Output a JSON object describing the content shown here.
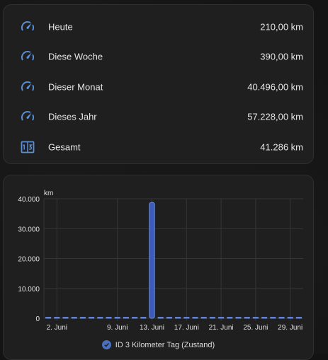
{
  "entities": [
    {
      "icon": "speedometer-icon",
      "name": "Heute",
      "value": "210,00 km"
    },
    {
      "icon": "speedometer-icon",
      "name": "Diese Woche",
      "value": "390,00 km"
    },
    {
      "icon": "speedometer-icon",
      "name": "Dieser Monat",
      "value": "40.496,00 km"
    },
    {
      "icon": "speedometer-icon",
      "name": "Dieses Jahr",
      "value": "57.228,00 km"
    },
    {
      "icon": "counter-icon",
      "name": "Gesamt",
      "value": "41.286 km"
    }
  ],
  "colors": {
    "icon": "#5b8fd6",
    "bar_fill": "#3b5cb8",
    "bar_stroke": "#6d8de0",
    "grid": "#353535"
  },
  "chart_data": {
    "type": "bar",
    "ylabel": "km",
    "ylim": [
      0,
      40000
    ],
    "yticks": [
      "40.000",
      "30.000",
      "20.000",
      "10.000",
      "0"
    ],
    "ytick_values": [
      40000,
      30000,
      20000,
      10000,
      0
    ],
    "xticks": [
      "2. Juni",
      "9. Juni",
      "13. Juni",
      "17. Juni",
      "21. Juni",
      "25. Juni",
      "29. Juni"
    ],
    "xtick_days": [
      2,
      9,
      13,
      17,
      21,
      25,
      29
    ],
    "categories": [
      1,
      2,
      3,
      4,
      5,
      6,
      7,
      8,
      9,
      10,
      11,
      12,
      13,
      14,
      15,
      16,
      17,
      18,
      19,
      20,
      21,
      22,
      23,
      24,
      25,
      26,
      27,
      28,
      29,
      30
    ],
    "series": [
      {
        "name": "ID 3 Kilometer Tag (Zustand)",
        "values": [
          30,
          40,
          30,
          20,
          50,
          30,
          40,
          30,
          40,
          30,
          30,
          40,
          38800,
          40,
          30,
          50,
          40,
          30,
          30,
          40,
          40,
          30,
          30,
          40,
          30,
          40,
          30,
          30,
          40,
          30
        ]
      }
    ]
  }
}
